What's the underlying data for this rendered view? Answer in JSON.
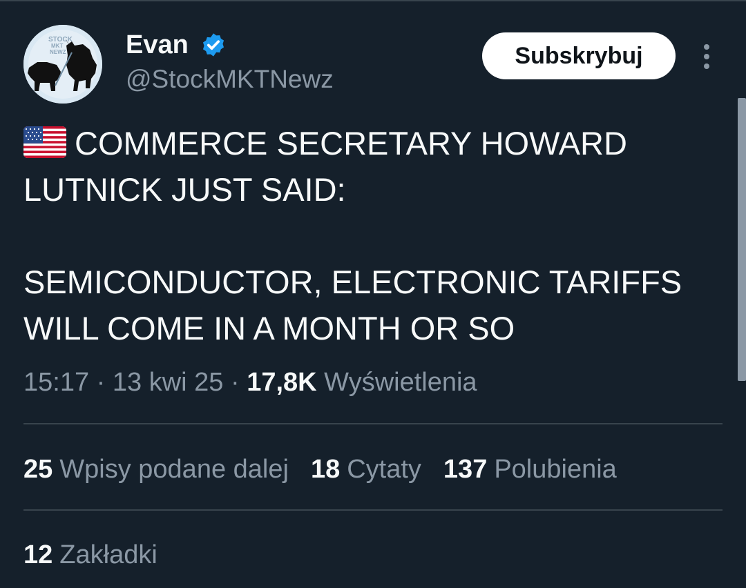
{
  "author": {
    "display_name": "Evan",
    "handle": "@StockMKTNewz",
    "verified": true,
    "avatar_icon": "stock-mkt-newz-bull-bear-logo",
    "avatar_text": "STOCK MKT NEWZ"
  },
  "actions": {
    "subscribe_label": "Subskrybuj",
    "more_icon": "more-vertical-icon"
  },
  "tweet": {
    "flag": "us-flag-emoji",
    "lines": [
      "COMMERCE SECRETARY HOWARD",
      "LUTNICK JUST SAID:",
      "",
      "SEMICONDUCTOR, ELECTRONIC TARIFFS",
      "WILL COME IN A MONTH OR SO"
    ]
  },
  "meta": {
    "time": "15:17",
    "separator": " · ",
    "date": "13 kwi 25",
    "views_count": "17,8K",
    "views_label": "Wyświetlenia"
  },
  "stats": {
    "reposts": {
      "count": "25",
      "label": "Wpisy podane dalej"
    },
    "quotes": {
      "count": "18",
      "label": "Cytaty"
    },
    "likes": {
      "count": "137",
      "label": "Polubienia"
    },
    "bookmarks": {
      "count": "12",
      "label": "Zakładki"
    }
  },
  "colors": {
    "background": "#15202b",
    "text_primary": "#f7f9f9",
    "text_secondary": "#8b98a5",
    "divider": "#38444d",
    "verified_badge": "#1d9bf0"
  }
}
